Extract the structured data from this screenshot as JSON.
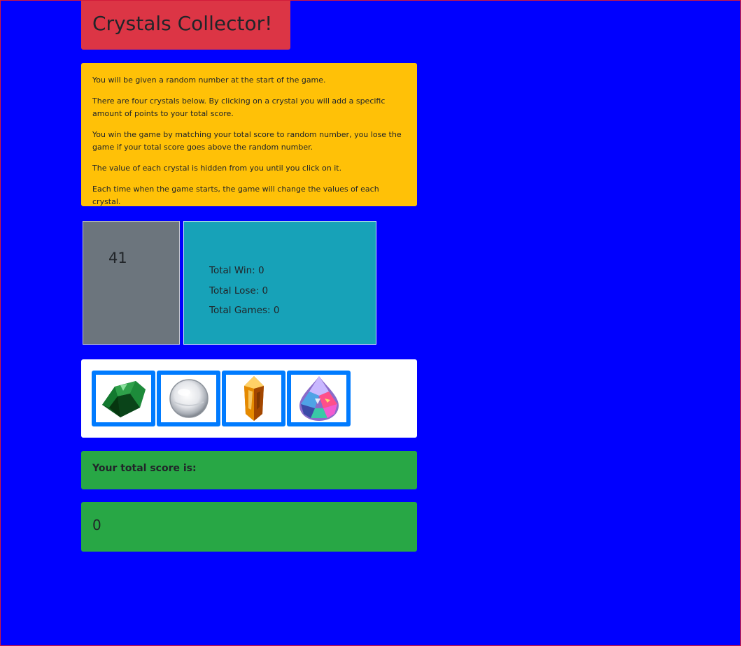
{
  "header": {
    "title": "Crystals Collector!"
  },
  "instructions": [
    "You will be given a random number at the start of the game.",
    "There are four crystals below. By clicking on a crystal you will add a specific amount of points to your total score.",
    "You win the game by matching your total score to random number, you lose the game if your total score goes above the random number.",
    "The value of each crystal is hidden from you until you click on it.",
    "Each time when the game starts, the game will change the values of each crystal."
  ],
  "target": {
    "value": "41"
  },
  "stats": {
    "wins": "Total Win: 0",
    "losses": "Total Lose: 0",
    "games": "Total Games: 0"
  },
  "crystals": [
    {
      "icon": "green-crystal-icon"
    },
    {
      "icon": "white-crystal-icon"
    },
    {
      "icon": "orange-crystal-icon"
    },
    {
      "icon": "rainbow-crystal-icon"
    }
  ],
  "score": {
    "label": "Your total score is:",
    "value": "0"
  },
  "colors": {
    "background": "#0000ff",
    "title_bg": "#dc3545",
    "instructions_bg": "#ffc107",
    "target_bg": "#6c757d",
    "stats_bg": "#17a2b8",
    "crystal_border": "#007bff",
    "score_bg": "#28a745"
  }
}
